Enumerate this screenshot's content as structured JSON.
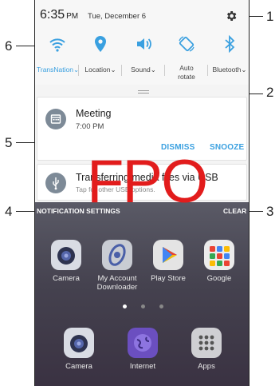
{
  "status_bar": {
    "time": "6:35",
    "ampm": "PM",
    "date": "Tue, December 6"
  },
  "quick_settings": [
    {
      "label": "TransNation",
      "icon": "wifi-icon",
      "active": true
    },
    {
      "label": "Location",
      "icon": "location-icon",
      "active": false
    },
    {
      "label": "Sound",
      "icon": "sound-icon",
      "active": false
    },
    {
      "label": "Auto rotate",
      "icon": "auto-rotate-icon",
      "active": false
    },
    {
      "label": "Bluetooth",
      "icon": "bluetooth-icon",
      "active": false
    }
  ],
  "notifications": {
    "meeting": {
      "title": "Meeting",
      "subtitle": "7:00 PM",
      "dismiss": "DISMISS",
      "snooze": "SNOOZE"
    },
    "usb": {
      "title": "Transferring media files via USB",
      "subtitle": "Tap for other USB options."
    }
  },
  "footer": {
    "settings": "NOTIFICATION SETTINGS",
    "clear": "CLEAR"
  },
  "home": {
    "row1": [
      {
        "label": "Camera"
      },
      {
        "label": "My Account Downloader"
      },
      {
        "label": "Play Store"
      },
      {
        "label": "Google"
      }
    ],
    "dock": [
      {
        "label": "Camera"
      },
      {
        "label": "Internet"
      },
      {
        "label": "Apps"
      }
    ]
  },
  "overlay": {
    "text": "FPO"
  },
  "callouts": [
    "1",
    "2",
    "3",
    "4",
    "5",
    "6"
  ],
  "colors": {
    "accent": "#3aa0e0",
    "fpo": "#e21c1c"
  }
}
